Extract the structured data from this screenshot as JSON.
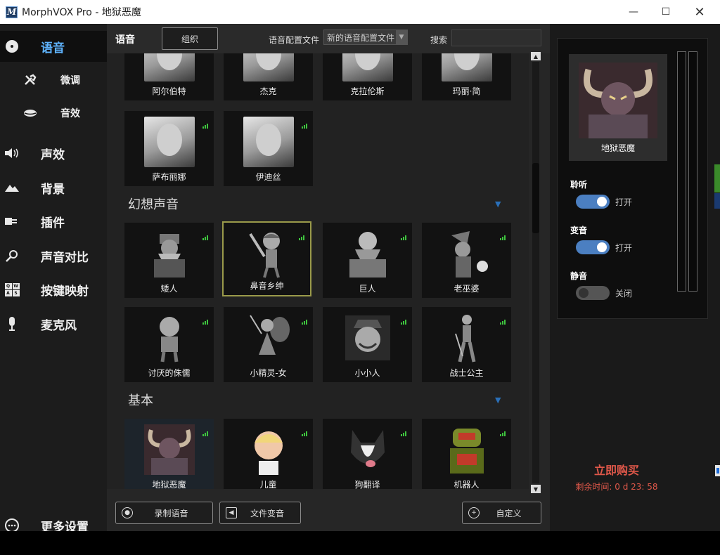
{
  "window": {
    "app_icon_letter": "M",
    "title": "MorphVOX Pro - 地狱恶魔",
    "minimize": "—",
    "maximize": "☐",
    "close": "✕"
  },
  "sidebar": {
    "items": [
      {
        "label": "语音"
      },
      {
        "label": "微调"
      },
      {
        "label": "音效"
      },
      {
        "label": "声效"
      },
      {
        "label": "背景"
      },
      {
        "label": "插件"
      },
      {
        "label": "声音对比"
      },
      {
        "label": "按键映射"
      },
      {
        "label": "麦克风"
      },
      {
        "label": "更多设置"
      }
    ],
    "keymap_icon_keys": [
      "Q",
      "W",
      "A",
      "S"
    ]
  },
  "toolbar": {
    "title": "语音",
    "organize_label": "组织",
    "profile_label": "语音配置文件",
    "profile_value": "新的语音配置文件",
    "search_label": "搜索",
    "search_placeholder": ""
  },
  "voices": {
    "top_row": [
      {
        "name": "阿尔伯特"
      },
      {
        "name": "杰克"
      },
      {
        "name": "克拉伦斯"
      },
      {
        "name": "玛丽·简"
      }
    ],
    "row2": [
      {
        "name": "萨布丽娜"
      },
      {
        "name": "伊迪丝"
      }
    ],
    "fantasy": {
      "title": "幻想声音",
      "items": [
        {
          "name": "矮人"
        },
        {
          "name": "鼻音乡绅"
        },
        {
          "name": "巨人"
        },
        {
          "name": "老巫婆"
        },
        {
          "name": "讨厌的侏儒"
        },
        {
          "name": "小精灵-女"
        },
        {
          "name": "小小人"
        },
        {
          "name": "战士公主"
        }
      ]
    },
    "basic": {
      "title": "基本",
      "items": [
        {
          "name": "地狱恶魔"
        },
        {
          "name": "儿童"
        },
        {
          "name": "狗翻译"
        },
        {
          "name": "机器人"
        }
      ]
    }
  },
  "bottom": {
    "record_label": "录制语音",
    "file_label": "文件变音",
    "custom_label": "自定义"
  },
  "right_panel": {
    "current_voice": "地狱恶魔",
    "listen": {
      "label": "聆听",
      "state": "打开",
      "on": true
    },
    "morph": {
      "label": "变音",
      "state": "打开",
      "on": true
    },
    "mute": {
      "label": "静音",
      "state": "关闭",
      "on": false
    },
    "buy_label": "立即购买",
    "remaining": "剩余时间: 0 d 23: 58"
  },
  "colors": {
    "accent_blue": "#5fb4ff",
    "toggle_on": "#4b7fc1",
    "buy_red": "#e0584a",
    "signal_green": "#3ec43e"
  }
}
